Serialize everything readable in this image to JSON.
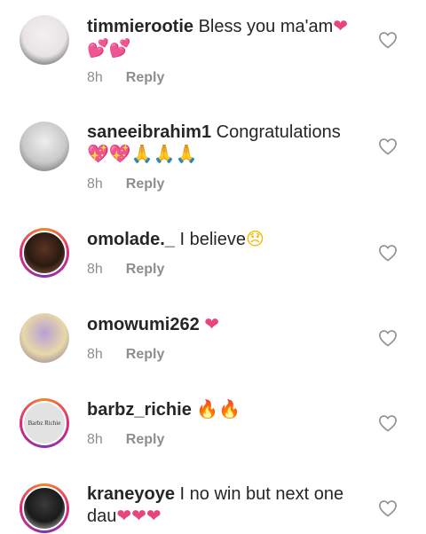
{
  "comments": [
    {
      "username": "timmierootie",
      "text": "Bless you ma'am",
      "emojis": [
        {
          "glyph": "❤",
          "icon": "heart-emoji",
          "cls": "e-heart"
        },
        {
          "glyph": "💕",
          "icon": "two-hearts-emoji",
          "cls": "e-twohearts"
        },
        {
          "glyph": "💕",
          "icon": "two-hearts-emoji",
          "cls": "e-twohearts"
        }
      ],
      "time": "8h",
      "reply": "Reply",
      "avatar": {
        "type": "photo",
        "colors": [
          "#e8e4e6",
          "#f4f0f2",
          "#2b2b2b"
        ]
      }
    },
    {
      "username": "saneeibrahim1",
      "text": "Congratulations",
      "emojis": [
        {
          "glyph": "💖",
          "icon": "sparkling-heart-emoji",
          "cls": "e-sparkle"
        },
        {
          "glyph": "💖",
          "icon": "sparkling-heart-emoji",
          "cls": "e-sparkle"
        },
        {
          "glyph": "🙏",
          "icon": "folded-hands-emoji",
          "cls": "e-pray"
        },
        {
          "glyph": "🙏",
          "icon": "folded-hands-emoji",
          "cls": "e-pray"
        },
        {
          "glyph": "🙏",
          "icon": "folded-hands-emoji",
          "cls": "e-pray"
        }
      ],
      "time": "8h",
      "reply": "Reply",
      "avatar": {
        "type": "photo",
        "colors": [
          "#c9c9c9",
          "#eeeeee",
          "#555555"
        ]
      }
    },
    {
      "username": "omolade._",
      "text": "I believe",
      "emojis": [
        {
          "glyph": "😞",
          "icon": "disappointed-face-emoji",
          "cls": "e-face"
        }
      ],
      "time": "8h",
      "reply": "Reply",
      "avatar": {
        "type": "story",
        "colors": [
          "#2a1a12",
          "#5a3322",
          "#9a6a52"
        ]
      }
    },
    {
      "username": "omowumi262",
      "text": "",
      "emojis": [
        {
          "glyph": "❤",
          "icon": "heart-emoji",
          "cls": "e-heart"
        }
      ],
      "time": "8h",
      "reply": "Reply",
      "avatar": {
        "type": "photo",
        "colors": [
          "#e8d8a8",
          "#b79fd6",
          "#7a6a9a"
        ]
      }
    },
    {
      "username": "barbz_richie",
      "text": "",
      "emojis": [
        {
          "glyph": "🔥",
          "icon": "fire-emoji",
          "cls": "e-fire"
        },
        {
          "glyph": "🔥",
          "icon": "fire-emoji",
          "cls": "e-fire"
        }
      ],
      "time": "8h",
      "reply": "Reply",
      "avatar": {
        "type": "story",
        "colors": [
          "#e2e2e2",
          "#cfcfcf",
          "#333333"
        ]
      }
    },
    {
      "username": "kraneyoye",
      "text": "I no win but next one dau",
      "emojis": [
        {
          "glyph": "❤",
          "icon": "heart-emoji",
          "cls": "e-heart"
        },
        {
          "glyph": "❤",
          "icon": "heart-emoji",
          "cls": "e-heart"
        },
        {
          "glyph": "❤",
          "icon": "heart-emoji",
          "cls": "e-heart"
        }
      ],
      "time": "",
      "reply": "",
      "avatar": {
        "type": "story",
        "colors": [
          "#1a1a1a",
          "#3a3a3a",
          "#d8d8d8"
        ]
      }
    }
  ],
  "avatar_logo_text": "Barbz Richie",
  "like_icon": "heart-outline-icon"
}
